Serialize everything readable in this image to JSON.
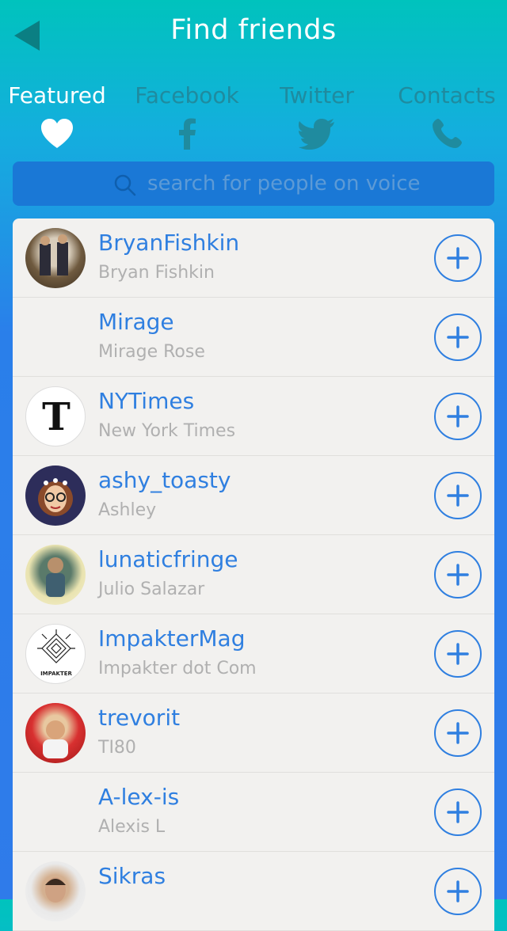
{
  "header": {
    "title": "Find friends",
    "back_icon": "back-arrow-icon"
  },
  "tabs": [
    {
      "label": "Featured",
      "icon": "heart-icon",
      "active": true
    },
    {
      "label": "Facebook",
      "icon": "facebook-icon",
      "active": false
    },
    {
      "label": "Twitter",
      "icon": "twitter-icon",
      "active": false
    },
    {
      "label": "Contacts",
      "icon": "phone-icon",
      "active": false
    }
  ],
  "search": {
    "placeholder": "search for people on voice",
    "value": ""
  },
  "friends": [
    {
      "username": "BryanFishkin",
      "fullname": "Bryan Fishkin",
      "avatar": "photo"
    },
    {
      "username": "Mirage",
      "fullname": "Mirage Rose",
      "avatar": "none"
    },
    {
      "username": "NYTimes",
      "fullname": "New York Times",
      "avatar": "nyt-logo"
    },
    {
      "username": "ashy_toasty",
      "fullname": "Ashley",
      "avatar": "cartoon"
    },
    {
      "username": "lunaticfringe",
      "fullname": "Julio Salazar",
      "avatar": "photo"
    },
    {
      "username": "ImpakterMag",
      "fullname": "Impakter dot Com",
      "avatar": "impakter-logo",
      "logo_text": "IMPAKTER"
    },
    {
      "username": "trevorit",
      "fullname": "TI80",
      "avatar": "photo"
    },
    {
      "username": "A-lex-is",
      "fullname": "Alexis L",
      "avatar": "none"
    },
    {
      "username": "Sikras",
      "fullname": "",
      "avatar": "photo"
    }
  ],
  "colors": {
    "accent": "#2f7fe0",
    "tab_inactive": "#1f8b9f",
    "list_bg": "#f2f1ef"
  }
}
